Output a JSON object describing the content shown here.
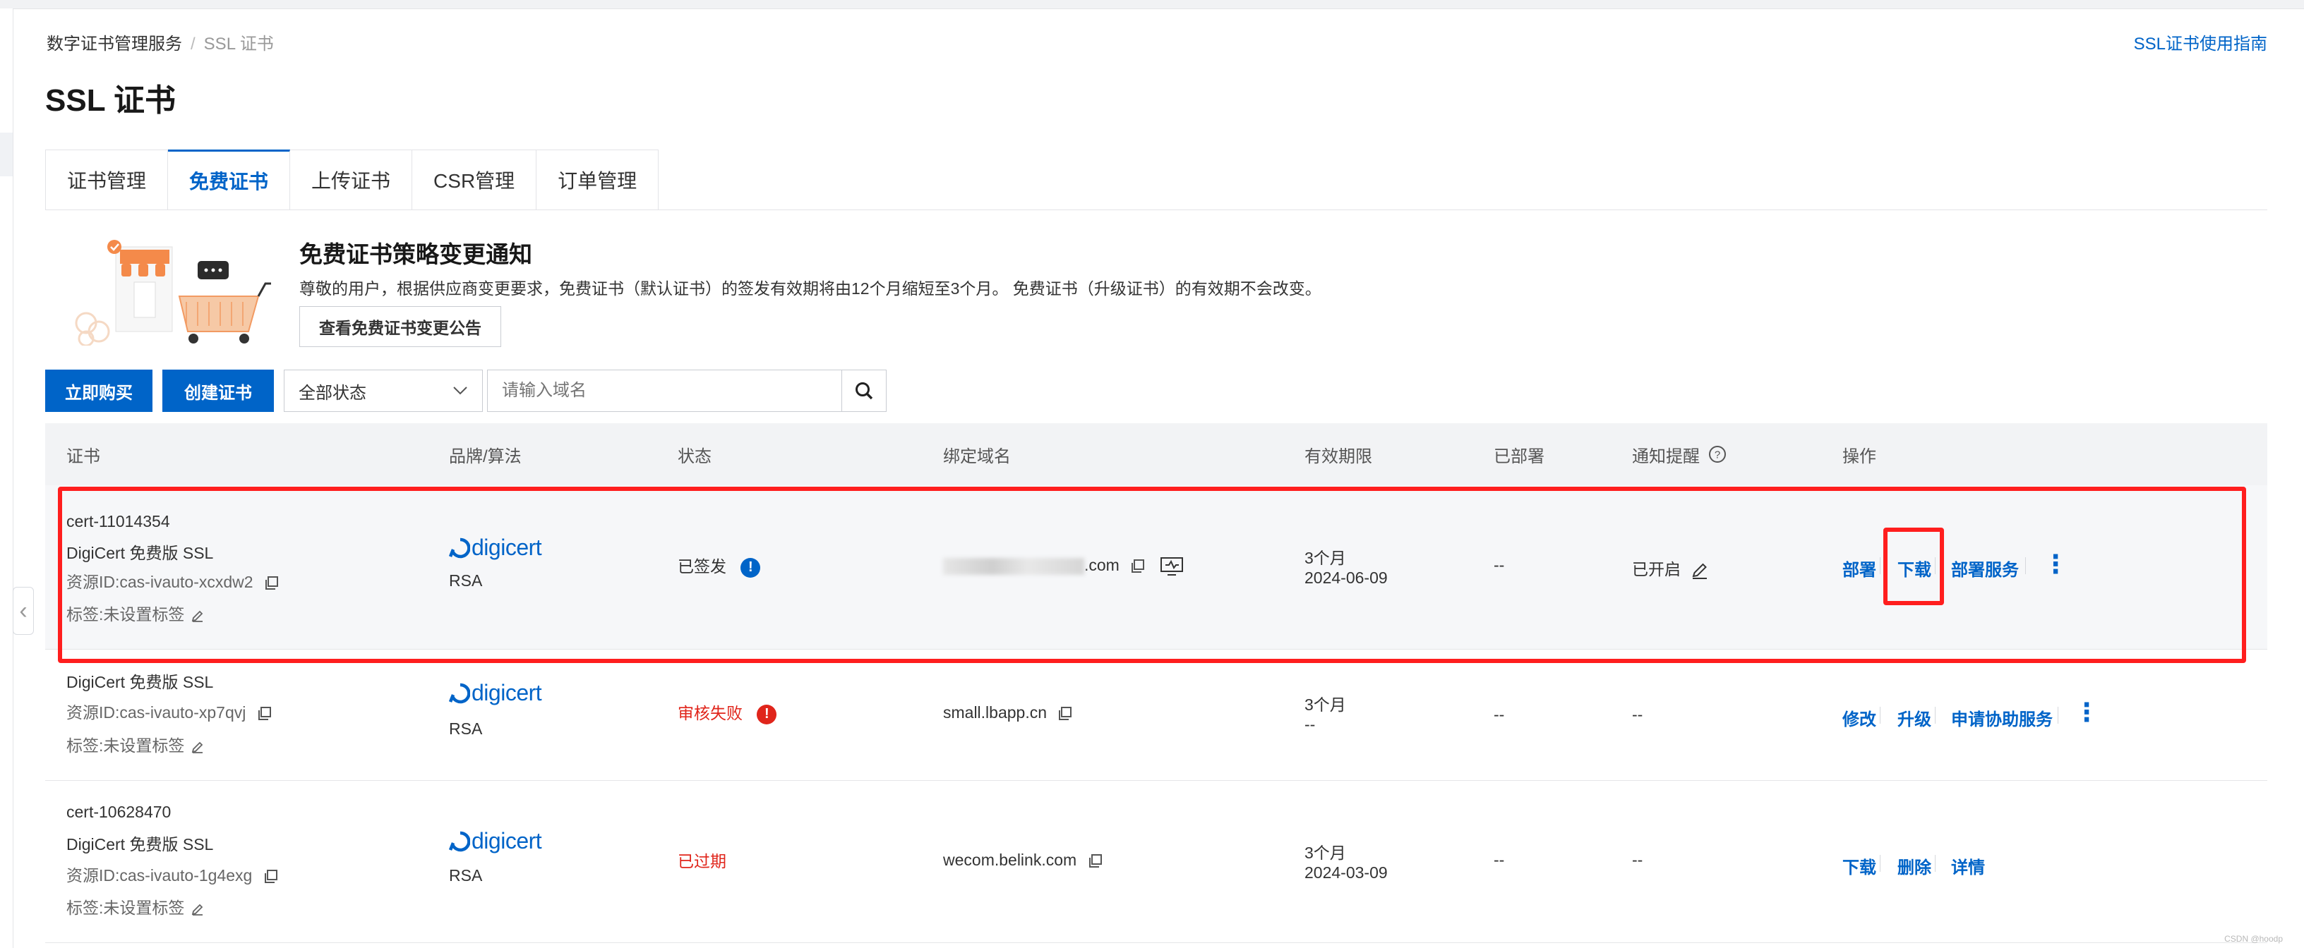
{
  "breadcrumb": {
    "root": "数字证书管理服务",
    "separator": "/",
    "current": "SSL 证书"
  },
  "guide_link": "SSL证书使用指南",
  "page_title": "SSL 证书",
  "tabs": [
    "证书管理",
    "免费证书",
    "上传证书",
    "CSR管理",
    "订单管理"
  ],
  "active_tab": "免费证书",
  "notice": {
    "title": "免费证书策略变更通知",
    "text": "尊敬的用户，根据供应商变更要求，免费证书（默认证书）的签发有效期将由12个月缩短至3个月。 免费证书（升级证书）的有效期不会改变。",
    "button": "查看免费证书变更公告"
  },
  "toolbar": {
    "buy_button": "立即购买",
    "create_button": "创建证书",
    "status_select": "全部状态",
    "search_placeholder": "请输入域名"
  },
  "table": {
    "headers": {
      "cert": "证书",
      "brand": "品牌/算法",
      "status": "状态",
      "domain": "绑定域名",
      "validity": "有效期限",
      "deployed": "已部署",
      "notify": "通知提醒",
      "actions": "操作"
    },
    "rows": [
      {
        "cert_id": "cert-11014354",
        "cert_name": "DigiCert 免费版 SSL",
        "resource_id": "资源ID:cas-ivauto-xcxdw2",
        "tag": "标签:未设置标签",
        "brand": "digicert",
        "algo": "RSA",
        "status": "已签发",
        "status_color": "#0064c8",
        "domain": ".com",
        "validity": "3个月",
        "expiry": "2024-06-09",
        "deployed": "--",
        "notify": "已开启",
        "actions": [
          "部署",
          "下载",
          "部署服务"
        ]
      },
      {
        "cert_id": "",
        "cert_name": "DigiCert 免费版 SSL",
        "resource_id": "资源ID:cas-ivauto-xp7qvj",
        "tag": "标签:未设置标签",
        "brand": "digicert",
        "algo": "RSA",
        "status": "审核失败",
        "status_color": "#e0251b",
        "domain": "small.lbapp.cn",
        "validity": "3个月",
        "expiry": "--",
        "deployed": "--",
        "notify": "--",
        "actions": [
          "修改",
          "升级",
          "申请协助服务"
        ]
      },
      {
        "cert_id": "cert-10628470",
        "cert_name": "DigiCert 免费版 SSL",
        "resource_id": "资源ID:cas-ivauto-1g4exg",
        "tag": "标签:未设置标签",
        "brand": "digicert",
        "algo": "RSA",
        "status": "已过期",
        "status_color": "#e0251b",
        "domain": "wecom.belink.com",
        "validity": "3个月",
        "expiry": "2024-03-09",
        "deployed": "--",
        "notify": "--",
        "actions": [
          "下载",
          "删除",
          "详情"
        ]
      }
    ]
  },
  "watermark": "CSDN @hoodp",
  "colors": {
    "accent": "#0064c8",
    "highlight": "#ff1e1e",
    "error": "#e0251b"
  }
}
